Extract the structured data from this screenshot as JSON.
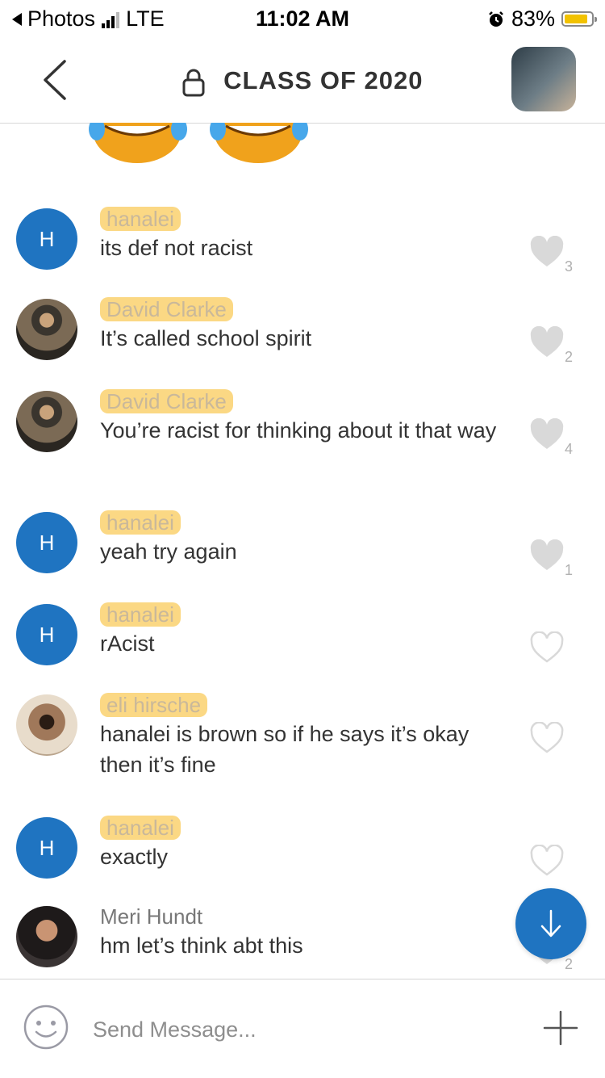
{
  "status_bar": {
    "back_app": "Photos",
    "network": "LTE",
    "time": "11:02 AM",
    "battery": "83%",
    "battery_color": "#f2c200"
  },
  "header": {
    "title": "CLASS OF 2020",
    "back_icon": "chevron-left-icon",
    "lock_icon": "lock-icon"
  },
  "messages": [
    {
      "sender": "hanalei",
      "avatar": "H",
      "text": "its def not racist",
      "likes": "3",
      "liked": true
    },
    {
      "sender": "David Clarke",
      "avatar": "",
      "text": "It’s called school spirit",
      "likes": "2",
      "liked": true
    },
    {
      "sender": "David Clarke",
      "avatar": "",
      "text": "You’re racist for thinking about it that way",
      "likes": "4",
      "liked": true
    },
    {
      "sender": "hanalei",
      "avatar": "H",
      "text": "yeah try again",
      "likes": "1",
      "liked": true
    },
    {
      "sender": "hanalei",
      "avatar": "H",
      "text": "rAcist",
      "likes": "",
      "liked": false
    },
    {
      "sender": "eli hirsche",
      "avatar": "",
      "text": "hanalei is brown so if he says it’s okay then it’s fine",
      "likes": "",
      "liked": false
    },
    {
      "sender": "hanalei",
      "avatar": "H",
      "text": "exactly",
      "likes": "",
      "liked": false
    },
    {
      "sender": "Meri Hundt",
      "avatar": "",
      "text": "hm let’s think abt this",
      "likes": "2",
      "liked": true
    }
  ],
  "composer": {
    "placeholder": "Send Message...",
    "emoji_icon": "smiley-icon",
    "add_icon": "plus-icon"
  },
  "scroll_button_icon": "arrow-down-icon",
  "colors": {
    "accent": "#1f74c1",
    "highlight": "#fac850",
    "heart": "#d9d9d9"
  }
}
